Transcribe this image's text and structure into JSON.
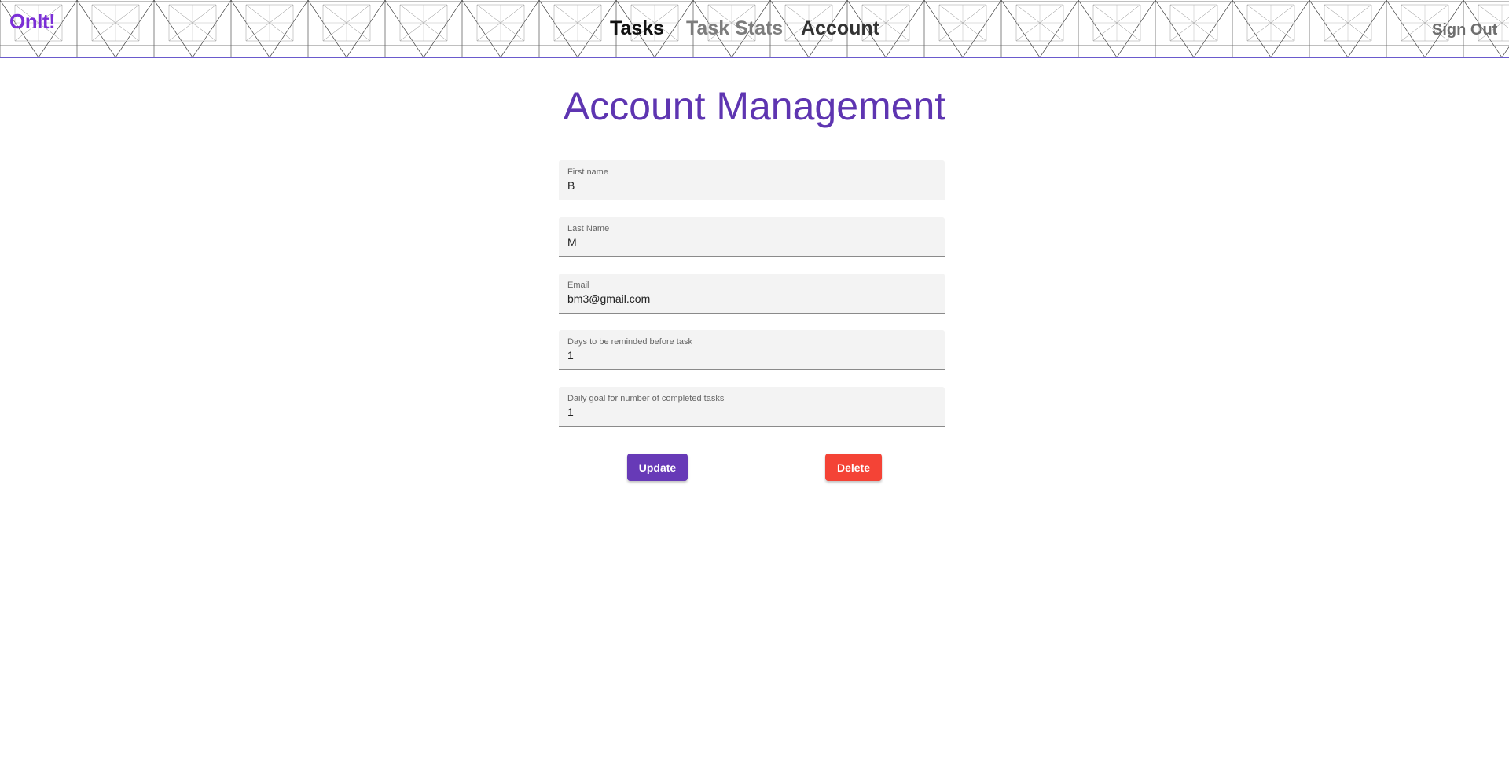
{
  "header": {
    "brand": "OnIt!",
    "nav": {
      "tasks": "Tasks",
      "task_stats": "Task Stats",
      "account": "Account"
    },
    "sign_out": "Sign Out"
  },
  "main": {
    "title": "Account Management",
    "fields": [
      {
        "label": "First name",
        "value": "B"
      },
      {
        "label": "Last Name",
        "value": "M"
      },
      {
        "label": "Email",
        "value": "bm3@gmail.com"
      },
      {
        "label": "Days to be reminded before task",
        "value": "1"
      },
      {
        "label": "Daily goal for number of completed tasks",
        "value": "1"
      }
    ],
    "buttons": {
      "update": "Update",
      "delete": "Delete"
    }
  },
  "colors": {
    "brand": "#7b2fd6",
    "title": "#5e35b1",
    "update_button": "#673ab7",
    "delete_button": "#f44336"
  }
}
